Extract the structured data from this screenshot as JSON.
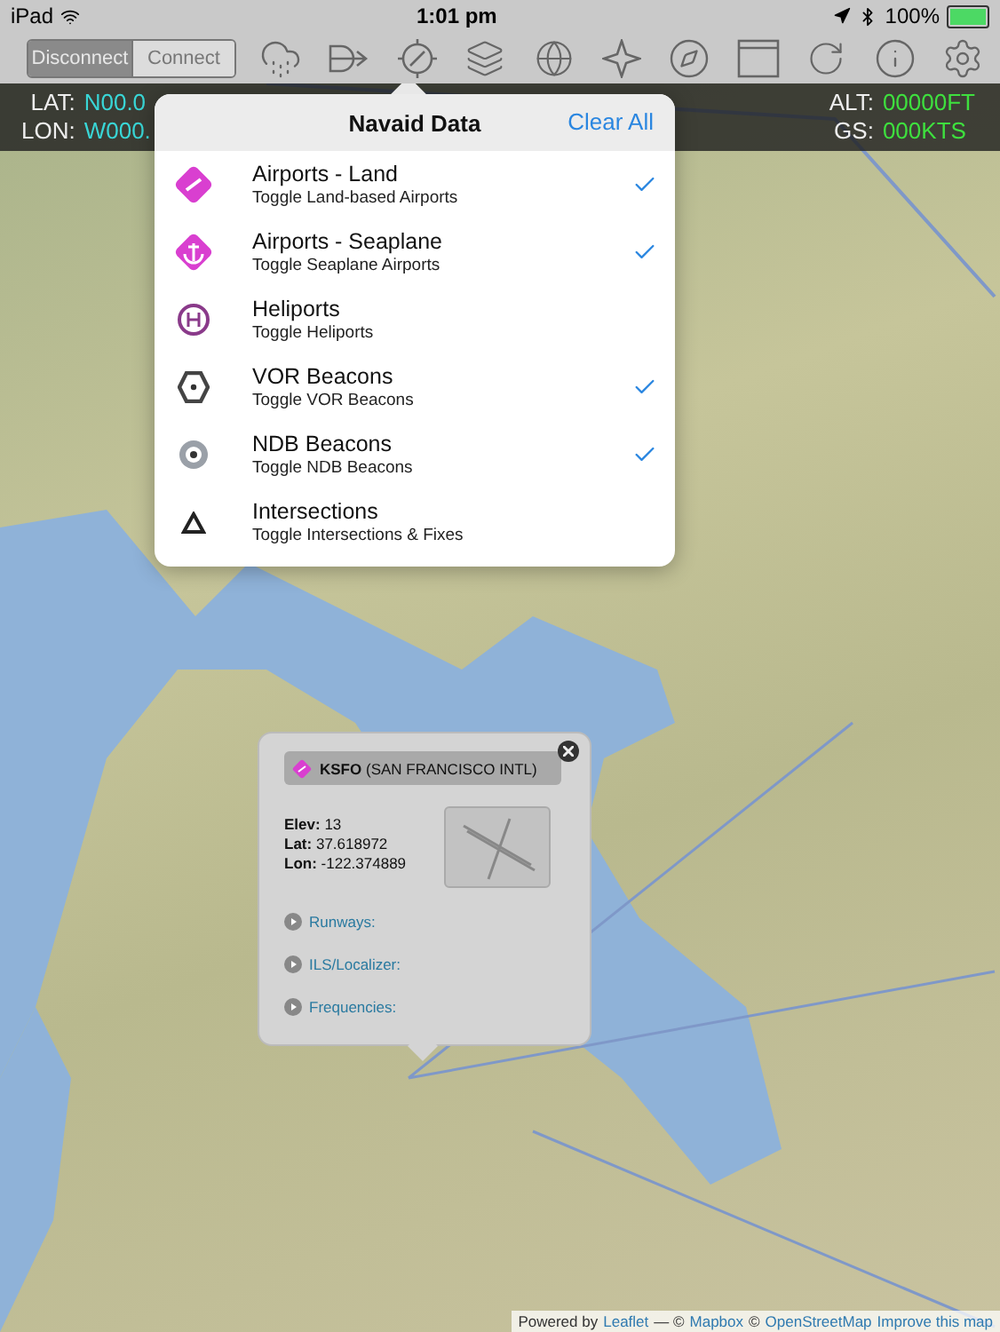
{
  "status_bar": {
    "device": "iPad",
    "time": "1:01 pm",
    "battery": "100%"
  },
  "connection": [
    {
      "label": "Disconnect",
      "selected": true
    },
    {
      "label": "Connect",
      "selected": false
    }
  ],
  "position": {
    "lat_label": "LAT:",
    "lat": "N00.0",
    "lon_label": "LON:",
    "lon": "W000.",
    "alt_label": "ALT:",
    "alt": "00000FT",
    "gs_label": "GS:",
    "gs": "000KTS"
  },
  "navaid_menu": {
    "title": "Navaid Data",
    "action": "Clear All",
    "items": [
      {
        "kind": "land",
        "title": "Airports - Land",
        "subtitle": "Toggle Land-based Airports",
        "checked": true
      },
      {
        "kind": "seaplane",
        "title": "Airports - Seaplane",
        "subtitle": "Toggle Seaplane Airports",
        "checked": true
      },
      {
        "kind": "heliport",
        "title": "Heliports",
        "subtitle": "Toggle Heliports",
        "checked": false
      },
      {
        "kind": "vor",
        "title": "VOR Beacons",
        "subtitle": "Toggle VOR Beacons",
        "checked": true
      },
      {
        "kind": "ndb",
        "title": "NDB Beacons",
        "subtitle": "Toggle NDB Beacons",
        "checked": true
      },
      {
        "kind": "intersection",
        "title": "Intersections",
        "subtitle": "Toggle Intersections & Fixes",
        "checked": false
      }
    ]
  },
  "airport_popup": {
    "ident": "KSFO",
    "name": "(SAN FRANCISCO INTL)",
    "details": [
      {
        "label": "Elev:",
        "value": "13"
      },
      {
        "label": "Lat:",
        "value": "37.618972"
      },
      {
        "label": "Lon:",
        "value": "-122.374889"
      }
    ],
    "sections": [
      "Runways:",
      "ILS/Localizer:",
      "Frequencies:"
    ]
  },
  "attribution": [
    {
      "kind": "text",
      "text": "Powered by"
    },
    {
      "kind": "link",
      "text": "Leaflet"
    },
    {
      "kind": "text",
      "text": "— ©"
    },
    {
      "kind": "link",
      "text": "Mapbox"
    },
    {
      "kind": "text",
      "text": "©"
    },
    {
      "kind": "link",
      "text": "OpenStreetMap"
    },
    {
      "kind": "link",
      "text": "Improve this map"
    }
  ]
}
